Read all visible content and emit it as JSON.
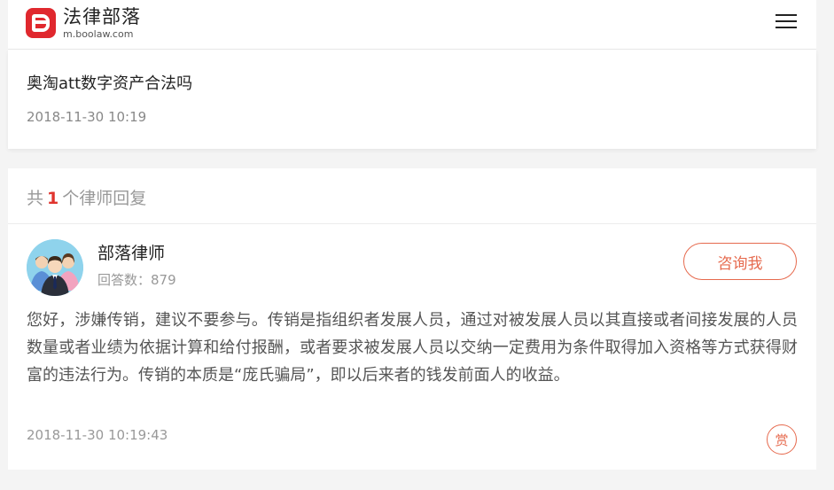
{
  "header": {
    "logo_name": "法律部落",
    "logo_url": "m.boolaw.com"
  },
  "question": {
    "title": "奥淘att数字资产合法吗",
    "time": "2018-11-30 10:19"
  },
  "answers": {
    "count_prefix": "共",
    "count": "1",
    "count_suffix": "个律师回复",
    "items": [
      {
        "lawyer_name": "部落律师",
        "answer_count": "回答数：879",
        "consult_label": "咨询我",
        "body": "您好，涉嫌传销，建议不要参与。传销是指组织者发展人员，通过对被发展人员以其直接或者间接发展的人员数量或者业绩为依据计算和给付报酬，或者要求被发展人员以交纳一定费用为条件取得加入资格等方式获得财富的违法行为。传销的本质是“庞氏骗局”，即以后来者的钱发前面人的收益。",
        "time": "2018-11-30 10:19:43",
        "reward_label": "赏"
      }
    ]
  },
  "colors": {
    "brand_red": "#e0282e",
    "accent_orange": "#e66a4e",
    "count_red": "#e0342e"
  },
  "icons": {
    "menu": "menu-icon",
    "logo": "boolaw-logo-icon",
    "avatar": "lawyer-group-avatar"
  }
}
